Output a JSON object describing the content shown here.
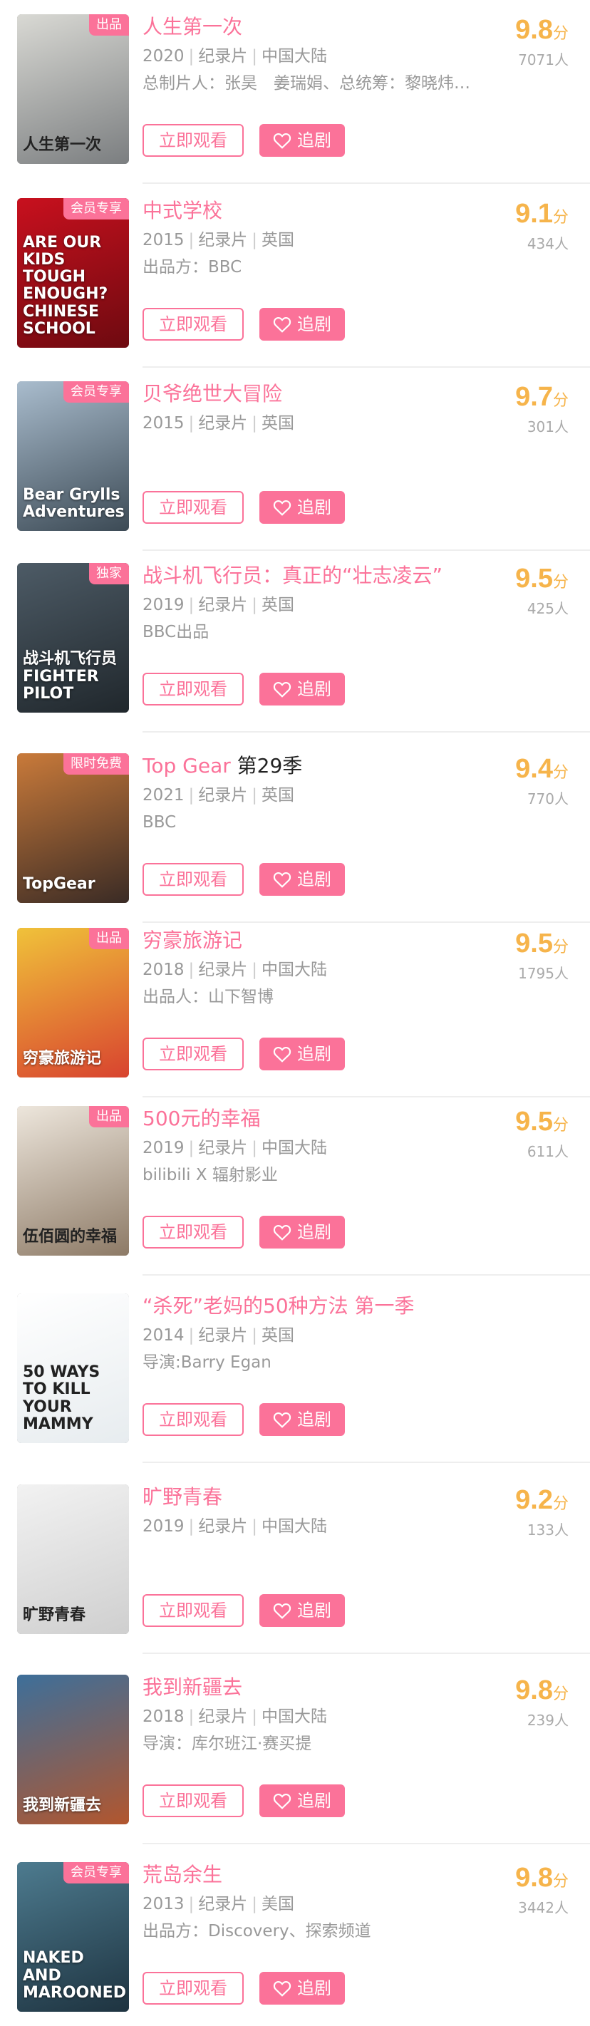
{
  "buttons": {
    "watch_label": "立即观看",
    "follow_label": "追剧"
  },
  "score_unit": "分",
  "items": [
    {
      "title": "人生第一次",
      "season": "",
      "badge": "出品",
      "year": "2020",
      "genre": "纪录片",
      "region": "中国大陆",
      "credit": "总制片人：张昊　姜瑞娟、总统筹：黎晓炜…",
      "score": "9.8",
      "count": "7071人",
      "poster_text": "人生第一次",
      "poster_colors": [
        "#d9d9d4",
        "#7b7e80"
      ]
    },
    {
      "title": "中式学校",
      "season": "",
      "badge": "会员专享",
      "year": "2015",
      "genre": "纪录片",
      "region": "英国",
      "credit": "出品方：BBC",
      "score": "9.1",
      "count": "434人",
      "poster_text": "ARE OUR KIDS TOUGH ENOUGH? CHINESE SCHOOL",
      "poster_colors": [
        "#c8101e",
        "#6e0a10"
      ]
    },
    {
      "title": "贝爷绝世大冒险",
      "season": "",
      "badge": "会员专享",
      "year": "2015",
      "genre": "纪录片",
      "region": "英国",
      "credit": "",
      "score": "9.7",
      "count": "301人",
      "poster_text": "Bear Grylls Adventures",
      "poster_colors": [
        "#a9bccd",
        "#3c4a55"
      ]
    },
    {
      "title": "战斗机飞行员：真正的“壮志凌云”",
      "season": "",
      "badge": "独家",
      "year": "2019",
      "genre": "纪录片",
      "region": "英国",
      "credit": "BBC出品",
      "score": "9.5",
      "count": "425人",
      "poster_text": "战斗机飞行员 FIGHTER PILOT",
      "poster_colors": [
        "#4d5b66",
        "#20272c"
      ]
    },
    {
      "title": "Top Gear",
      "season": "第29季",
      "badge": "限时免费",
      "year": "2021",
      "genre": "纪录片",
      "region": "英国",
      "credit": "BBC",
      "score": "9.4",
      "count": "770人",
      "poster_text": "TopGear",
      "poster_colors": [
        "#c97a3a",
        "#3a2b25"
      ]
    },
    {
      "title": "穷豪旅游记",
      "season": "",
      "badge": "出品",
      "year": "2018",
      "genre": "纪录片",
      "region": "中国大陆",
      "credit": "出品人：山下智博",
      "score": "9.5",
      "count": "1795人",
      "poster_text": "穷豪旅游记",
      "poster_colors": [
        "#f0c23a",
        "#d8432f"
      ]
    },
    {
      "title": "500元的幸福",
      "season": "",
      "badge": "出品",
      "year": "2019",
      "genre": "纪录片",
      "region": "中国大陆",
      "credit": "bilibili X 辐射影业",
      "score": "9.5",
      "count": "611人",
      "poster_text": "伍佰圆的幸福",
      "poster_colors": [
        "#ede6dc",
        "#8d7a66"
      ]
    },
    {
      "title": "“杀死”老妈的50种方法 第一季",
      "season": "",
      "badge": "",
      "year": "2014",
      "genre": "纪录片",
      "region": "英国",
      "credit": "导演:Barry Egan",
      "score": "",
      "count": "",
      "poster_text": "50 WAYS TO KILL YOUR MAMMY",
      "poster_colors": [
        "#ffffff",
        "#e7ecef"
      ]
    },
    {
      "title": "旷野青春",
      "season": "",
      "badge": "",
      "year": "2019",
      "genre": "纪录片",
      "region": "中国大陆",
      "credit": "",
      "score": "9.2",
      "count": "133人",
      "poster_text": "旷野青春",
      "poster_colors": [
        "#f2f2f2",
        "#cfcfcf"
      ]
    },
    {
      "title": "我到新疆去",
      "season": "",
      "badge": "",
      "year": "2018",
      "genre": "纪录片",
      "region": "中国大陆",
      "credit": "导演：库尔班江·赛买提",
      "score": "9.8",
      "count": "239人",
      "poster_text": "我到新疆去",
      "poster_colors": [
        "#3d6f9a",
        "#b2562e"
      ]
    },
    {
      "title": "荒岛余生",
      "season": "",
      "badge": "会员专享",
      "year": "2013",
      "genre": "纪录片",
      "region": "美国",
      "credit": "出品方：Discovery、探索频道",
      "score": "9.8",
      "count": "3442人",
      "poster_text": "NAKED AND MAROONED",
      "poster_colors": [
        "#4d7b8f",
        "#1e3340"
      ]
    }
  ]
}
